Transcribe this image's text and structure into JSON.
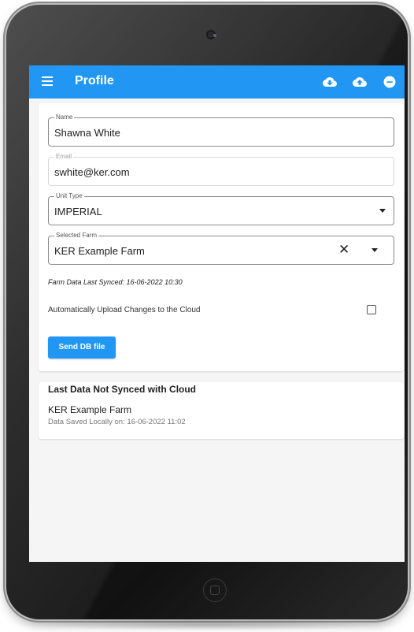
{
  "app": {
    "title": "Profile",
    "accent": "#2196f3",
    "actions": [
      {
        "icon": "cloud-download-icon"
      },
      {
        "icon": "cloud-upload-icon"
      },
      {
        "icon": "remove-circle-icon"
      }
    ]
  },
  "form": {
    "name": {
      "label": "Name",
      "value": "Shawna White"
    },
    "email": {
      "label": "Email",
      "value": "swhite@ker.com"
    },
    "unit_type": {
      "label": "Unit Type",
      "value": "IMPERIAL"
    },
    "selected_farm": {
      "label": "Selected Farm",
      "value": "KER Example Farm"
    },
    "sync_text": "Farm Data Last Synced: 16-06-2022 10:30",
    "auto_upload_label": "Automatically Upload Changes to the Cloud",
    "auto_upload_checked": false,
    "send_button": "Send DB file"
  },
  "unsynced": {
    "title": "Last Data Not Synced with Cloud",
    "items": [
      {
        "name": "KER Example Farm",
        "detail": "Data Saved Locally on: 16-06-2022 11:02"
      }
    ]
  }
}
